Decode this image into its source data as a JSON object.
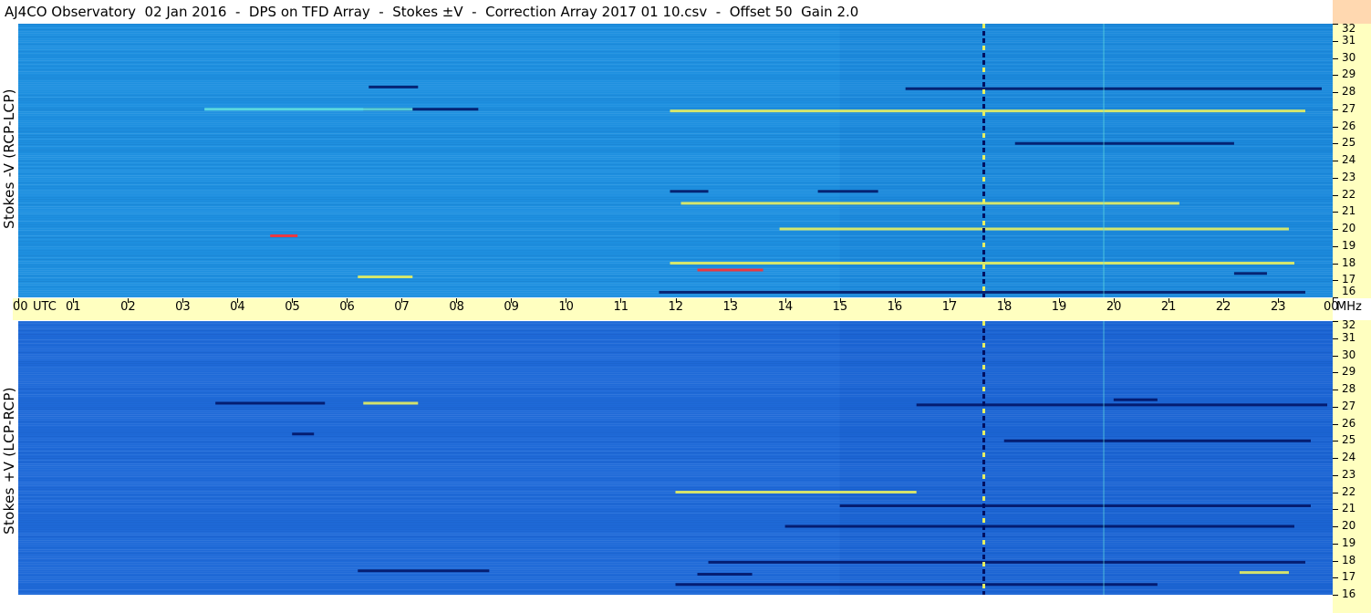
{
  "title": "AJ4CO Observatory  02 Jan 2016  -  DPS on TFD Array  -  Stokes ±V  -  Correction Array 2017 01 10.csv  -  Offset 50  Gain 2.0",
  "panels": {
    "top_label": "Stokes -V (RCP-LCP)",
    "bottom_label": "Stokes +V (LCP-RCP)"
  },
  "colors": {
    "background": "#1e90e0",
    "bottom_background": "#1f6ad8",
    "scale_bar": "#ffffc0",
    "dark_streak": "#001060",
    "yellow_streak": "#e8f060",
    "red_streak": "#ff3030",
    "cyan_streak": "#60e0e0"
  },
  "chart_data": {
    "type": "heatmap",
    "title": "AJ4CO Observatory  02 Jan 2016  -  DPS on TFD Array  -  Stokes ±V  -  Correction Array 2017 01 10.csv  -  Offset 50  Gain 2.0",
    "x_axis": {
      "unit_label": "UTC",
      "range": [
        0,
        24
      ],
      "tick_labels": [
        "00",
        "01",
        "02",
        "03",
        "04",
        "05",
        "06",
        "07",
        "08",
        "09",
        "10",
        "11",
        "12",
        "13",
        "14",
        "15",
        "16",
        "17",
        "18",
        "19",
        "20",
        "21",
        "22",
        "23",
        "00"
      ]
    },
    "y_axis": {
      "unit_label": "MHz",
      "range": [
        16,
        32
      ],
      "tick_labels": [
        "32",
        "31",
        "30",
        "29",
        "28",
        "27",
        "26",
        "25",
        "24",
        "23",
        "22",
        "21",
        "20",
        "19",
        "18",
        "17",
        "16"
      ]
    },
    "panels": [
      {
        "name": "Stokes -V (RCP-LCP)",
        "streaks": [
          {
            "t0": 6.3,
            "t1": 8.4,
            "f": 27.0,
            "kind": "dark"
          },
          {
            "t0": 3.4,
            "t1": 7.2,
            "f": 27.0,
            "kind": "cyan"
          },
          {
            "t0": 6.4,
            "t1": 7.3,
            "f": 28.3,
            "kind": "dark"
          },
          {
            "t0": 11.9,
            "t1": 23.5,
            "f": 26.9,
            "kind": "yellow"
          },
          {
            "t0": 16.2,
            "t1": 23.8,
            "f": 28.2,
            "kind": "dark"
          },
          {
            "t0": 18.2,
            "t1": 22.2,
            "f": 25.0,
            "kind": "dark"
          },
          {
            "t0": 11.9,
            "t1": 12.6,
            "f": 22.2,
            "kind": "dark"
          },
          {
            "t0": 14.6,
            "t1": 15.7,
            "f": 22.2,
            "kind": "dark"
          },
          {
            "t0": 12.1,
            "t1": 21.2,
            "f": 21.5,
            "kind": "yellow"
          },
          {
            "t0": 13.9,
            "t1": 23.2,
            "f": 20.0,
            "kind": "yellow"
          },
          {
            "t0": 11.9,
            "t1": 23.3,
            "f": 18.0,
            "kind": "yellow"
          },
          {
            "t0": 12.4,
            "t1": 13.6,
            "f": 17.6,
            "kind": "red"
          },
          {
            "t0": 6.2,
            "t1": 7.2,
            "f": 17.2,
            "kind": "yellow"
          },
          {
            "t0": 11.7,
            "t1": 23.5,
            "f": 16.3,
            "kind": "dark"
          },
          {
            "t0": 22.2,
            "t1": 22.8,
            "f": 17.4,
            "kind": "dark"
          },
          {
            "t0": 4.6,
            "t1": 5.1,
            "f": 19.6,
            "kind": "red"
          }
        ]
      },
      {
        "name": "Stokes +V (LCP-RCP)",
        "streaks": [
          {
            "t0": 3.6,
            "t1": 5.6,
            "f": 27.2,
            "kind": "dark"
          },
          {
            "t0": 6.3,
            "t1": 7.3,
            "f": 27.2,
            "kind": "yellow"
          },
          {
            "t0": 16.4,
            "t1": 23.9,
            "f": 27.1,
            "kind": "dark"
          },
          {
            "t0": 20.0,
            "t1": 20.8,
            "f": 27.4,
            "kind": "dark"
          },
          {
            "t0": 18.0,
            "t1": 23.6,
            "f": 25.0,
            "kind": "dark"
          },
          {
            "t0": 12.0,
            "t1": 16.4,
            "f": 22.0,
            "kind": "yellow"
          },
          {
            "t0": 15.0,
            "t1": 23.6,
            "f": 21.2,
            "kind": "dark"
          },
          {
            "t0": 14.0,
            "t1": 23.3,
            "f": 20.0,
            "kind": "dark"
          },
          {
            "t0": 12.6,
            "t1": 23.5,
            "f": 17.9,
            "kind": "dark"
          },
          {
            "t0": 12.4,
            "t1": 13.4,
            "f": 17.2,
            "kind": "dark"
          },
          {
            "t0": 22.3,
            "t1": 23.2,
            "f": 17.3,
            "kind": "yellow"
          },
          {
            "t0": 12.0,
            "t1": 20.8,
            "f": 16.6,
            "kind": "dark"
          },
          {
            "t0": 6.2,
            "t1": 8.6,
            "f": 17.4,
            "kind": "dark"
          },
          {
            "t0": 5.0,
            "t1": 5.4,
            "f": 25.4,
            "kind": "dark"
          }
        ]
      }
    ],
    "vertical_lines": [
      {
        "t": 17.63,
        "kind": "dotted"
      },
      {
        "t": 19.82,
        "kind": "faint"
      }
    ]
  }
}
